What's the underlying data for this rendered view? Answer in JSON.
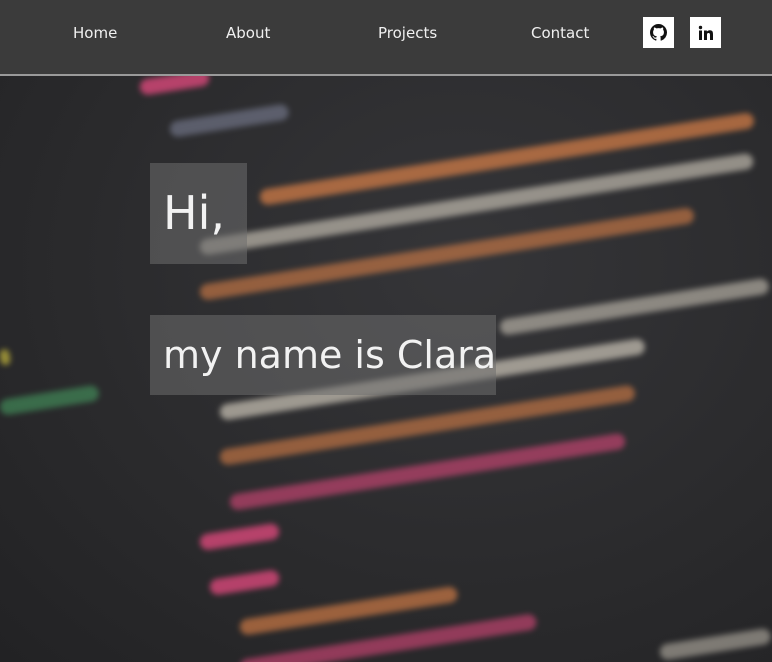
{
  "nav": {
    "links": [
      {
        "label": "Home"
      },
      {
        "label": "About"
      },
      {
        "label": "Projects"
      },
      {
        "label": "Contact"
      }
    ],
    "social": [
      {
        "icon": "github-icon"
      },
      {
        "icon": "linkedin-icon"
      }
    ]
  },
  "hero": {
    "greeting": "Hi,",
    "intro": "my name is Clara"
  },
  "colors": {
    "nav_bg": "#3b3b3b",
    "tag_pink": "#d9487a",
    "attr_orange": "#e8874a",
    "text_light": "#e8e8e8"
  }
}
